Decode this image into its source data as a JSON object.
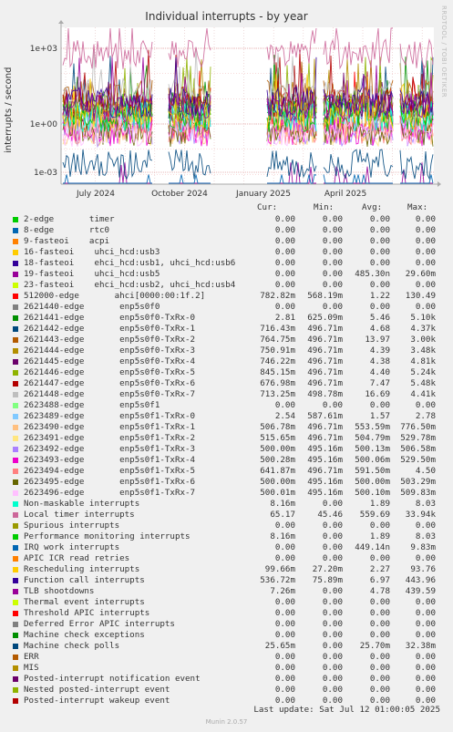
{
  "title": "Individual interrupts - by year",
  "watermark": "RRDTOOL / TOBI OETIKER",
  "footer": {
    "last_update": "Last update: Sat Jul 12 01:00:05 2025",
    "munin": "Munin 2.0.57"
  },
  "legend_headers": {
    "cur": "Cur:",
    "min": "Min:",
    "avg": "Avg:",
    "max": "Max:"
  },
  "chart_data": {
    "type": "line",
    "title": "Individual interrupts - by year",
    "ylabel": "interrupts / second",
    "yscale": "log",
    "ylim": [
      0.0001,
      30000
    ],
    "yticks": [
      "1e+03",
      "1e+00",
      "1e-03"
    ],
    "xticks": [
      "July 2024",
      "October 2024",
      "January 2025",
      "April 2025"
    ],
    "grid": true,
    "legend_placement": "bottom",
    "series": [
      {
        "name": "2-edge       timer",
        "color": "#00cc00",
        "cur": "0.00",
        "min": "0.00",
        "avg": "0.00",
        "max": "0.00"
      },
      {
        "name": "8-edge       rtc0",
        "color": "#0066b3",
        "cur": "0.00",
        "min": "0.00",
        "avg": "0.00",
        "max": "0.00"
      },
      {
        "name": "9-fasteoi    acpi",
        "color": "#ff8000",
        "cur": "0.00",
        "min": "0.00",
        "avg": "0.00",
        "max": "0.00"
      },
      {
        "name": "16-fasteoi    uhci_hcd:usb3",
        "color": "#ffcc00",
        "cur": "0.00",
        "min": "0.00",
        "avg": "0.00",
        "max": "0.00"
      },
      {
        "name": "18-fasteoi    ehci_hcd:usb1, uhci_hcd:usb6",
        "color": "#330099",
        "cur": "0.00",
        "min": "0.00",
        "avg": "0.00",
        "max": "0.00"
      },
      {
        "name": "19-fasteoi    uhci_hcd:usb5",
        "color": "#990099",
        "cur": "0.00",
        "min": "0.00",
        "avg": "485.30n",
        "max": "29.60m"
      },
      {
        "name": "23-fasteoi    ehci_hcd:usb2, uhci_hcd:usb4",
        "color": "#ccff00",
        "cur": "0.00",
        "min": "0.00",
        "avg": "0.00",
        "max": "0.00"
      },
      {
        "name": "512000-edge       ahci[0000:00:1f.2]",
        "color": "#ff0000",
        "cur": "782.82m",
        "min": "568.19m",
        "avg": "1.22",
        "max": "130.49"
      },
      {
        "name": "2621440-edge       enp5s0f0",
        "color": "#808080",
        "cur": "0.00",
        "min": "0.00",
        "avg": "0.00",
        "max": "0.00"
      },
      {
        "name": "2621441-edge       enp5s0f0-TxRx-0",
        "color": "#008f00",
        "cur": "2.81",
        "min": "625.09m",
        "avg": "5.46",
        "max": "5.10k"
      },
      {
        "name": "2621442-edge       enp5s0f0-TxRx-1",
        "color": "#00487d",
        "cur": "716.43m",
        "min": "496.71m",
        "avg": "4.68",
        "max": "4.37k"
      },
      {
        "name": "2621443-edge       enp5s0f0-TxRx-2",
        "color": "#b35a00",
        "cur": "764.75m",
        "min": "496.71m",
        "avg": "13.97",
        "max": "3.00k"
      },
      {
        "name": "2621444-edge       enp5s0f0-TxRx-3",
        "color": "#b38f00",
        "cur": "750.91m",
        "min": "496.71m",
        "avg": "4.39",
        "max": "3.48k"
      },
      {
        "name": "2621445-edge       enp5s0f0-TxRx-4",
        "color": "#6b006b",
        "cur": "746.22m",
        "min": "496.71m",
        "avg": "4.38",
        "max": "4.81k"
      },
      {
        "name": "2621446-edge       enp5s0f0-TxRx-5",
        "color": "#8fb300",
        "cur": "845.15m",
        "min": "496.71m",
        "avg": "4.40",
        "max": "5.24k"
      },
      {
        "name": "2621447-edge       enp5s0f0-TxRx-6",
        "color": "#b30000",
        "cur": "676.98m",
        "min": "496.71m",
        "avg": "7.47",
        "max": "5.48k"
      },
      {
        "name": "2621448-edge       enp5s0f0-TxRx-7",
        "color": "#bebebe",
        "cur": "713.25m",
        "min": "498.78m",
        "avg": "16.69",
        "max": "4.41k"
      },
      {
        "name": "2623488-edge       enp5s0f1",
        "color": "#80ff80",
        "cur": "0.00",
        "min": "0.00",
        "avg": "0.00",
        "max": "0.00"
      },
      {
        "name": "2623489-edge       enp5s0f1-TxRx-0",
        "color": "#80c9ff",
        "cur": "2.54",
        "min": "587.61m",
        "avg": "1.57",
        "max": "2.78"
      },
      {
        "name": "2623490-edge       enp5s0f1-TxRx-1",
        "color": "#ffc080",
        "cur": "506.78m",
        "min": "496.71m",
        "avg": "553.59m",
        "max": "776.50m"
      },
      {
        "name": "2623491-edge       enp5s0f1-TxRx-2",
        "color": "#ffe680",
        "cur": "515.65m",
        "min": "496.71m",
        "avg": "504.79m",
        "max": "529.78m"
      },
      {
        "name": "2623492-edge       enp5s0f1-TxRx-3",
        "color": "#aa80ff",
        "cur": "500.00m",
        "min": "495.16m",
        "avg": "500.13m",
        "max": "506.58m"
      },
      {
        "name": "2623493-edge       enp5s0f1-TxRx-4",
        "color": "#ee00cc",
        "cur": "500.28m",
        "min": "495.16m",
        "avg": "500.06m",
        "max": "529.50m"
      },
      {
        "name": "2623494-edge       enp5s0f1-TxRx-5",
        "color": "#ff8080",
        "cur": "641.87m",
        "min": "496.71m",
        "avg": "591.50m",
        "max": "4.50"
      },
      {
        "name": "2623495-edge       enp5s0f1-TxRx-6",
        "color": "#666600",
        "cur": "500.00m",
        "min": "495.16m",
        "avg": "500.00m",
        "max": "503.29m"
      },
      {
        "name": "2623496-edge       enp5s0f1-TxRx-7",
        "color": "#ffbfff",
        "cur": "500.01m",
        "min": "495.16m",
        "avg": "500.10m",
        "max": "509.83m"
      },
      {
        "name": "Non-maskable interrupts",
        "color": "#00ffcc",
        "cur": "8.16m",
        "min": "0.00",
        "avg": "1.89",
        "max": "8.03"
      },
      {
        "name": "Local timer interrupts",
        "color": "#cc6699",
        "cur": "65.17",
        "min": "45.46",
        "avg": "559.69",
        "max": "33.94k"
      },
      {
        "name": "Spurious interrupts",
        "color": "#999900",
        "cur": "0.00",
        "min": "0.00",
        "avg": "0.00",
        "max": "0.00"
      },
      {
        "name": "Performance monitoring interrupts",
        "color": "#00cc00",
        "cur": "8.16m",
        "min": "0.00",
        "avg": "1.89",
        "max": "8.03"
      },
      {
        "name": "IRQ work interrupts",
        "color": "#0066b3",
        "cur": "0.00",
        "min": "0.00",
        "avg": "449.14n",
        "max": "9.83m"
      },
      {
        "name": "APIC ICR read retries",
        "color": "#ff8000",
        "cur": "0.00",
        "min": "0.00",
        "avg": "0.00",
        "max": "0.00"
      },
      {
        "name": "Rescheduling interrupts",
        "color": "#ffcc00",
        "cur": "99.66m",
        "min": "27.20m",
        "avg": "2.27",
        "max": "93.76"
      },
      {
        "name": "Function call interrupts",
        "color": "#330099",
        "cur": "536.72m",
        "min": "75.89m",
        "avg": "6.97",
        "max": "443.96"
      },
      {
        "name": "TLB shootdowns",
        "color": "#990099",
        "cur": "7.26m",
        "min": "0.00",
        "avg": "4.78",
        "max": "439.59"
      },
      {
        "name": "Thermal event interrupts",
        "color": "#ccff00",
        "cur": "0.00",
        "min": "0.00",
        "avg": "0.00",
        "max": "0.00"
      },
      {
        "name": "Threshold APIC interrupts",
        "color": "#ff0000",
        "cur": "0.00",
        "min": "0.00",
        "avg": "0.00",
        "max": "0.00"
      },
      {
        "name": "Deferred Error APIC interrupts",
        "color": "#808080",
        "cur": "0.00",
        "min": "0.00",
        "avg": "0.00",
        "max": "0.00"
      },
      {
        "name": "Machine check exceptions",
        "color": "#008f00",
        "cur": "0.00",
        "min": "0.00",
        "avg": "0.00",
        "max": "0.00"
      },
      {
        "name": "Machine check polls",
        "color": "#00487d",
        "cur": "25.65m",
        "min": "0.00",
        "avg": "25.70m",
        "max": "32.38m"
      },
      {
        "name": "ERR",
        "color": "#b35a00",
        "cur": "0.00",
        "min": "0.00",
        "avg": "0.00",
        "max": "0.00"
      },
      {
        "name": "MIS",
        "color": "#b38f00",
        "cur": "0.00",
        "min": "0.00",
        "avg": "0.00",
        "max": "0.00"
      },
      {
        "name": "Posted-interrupt notification event",
        "color": "#6b006b",
        "cur": "0.00",
        "min": "0.00",
        "avg": "0.00",
        "max": "0.00"
      },
      {
        "name": "Nested posted-interrupt event",
        "color": "#8fb300",
        "cur": "0.00",
        "min": "0.00",
        "avg": "0.00",
        "max": "0.00"
      },
      {
        "name": "Posted-interrupt wakeup event",
        "color": "#b30000",
        "cur": "0.00",
        "min": "0.00",
        "avg": "0.00",
        "max": "0.00"
      }
    ]
  }
}
